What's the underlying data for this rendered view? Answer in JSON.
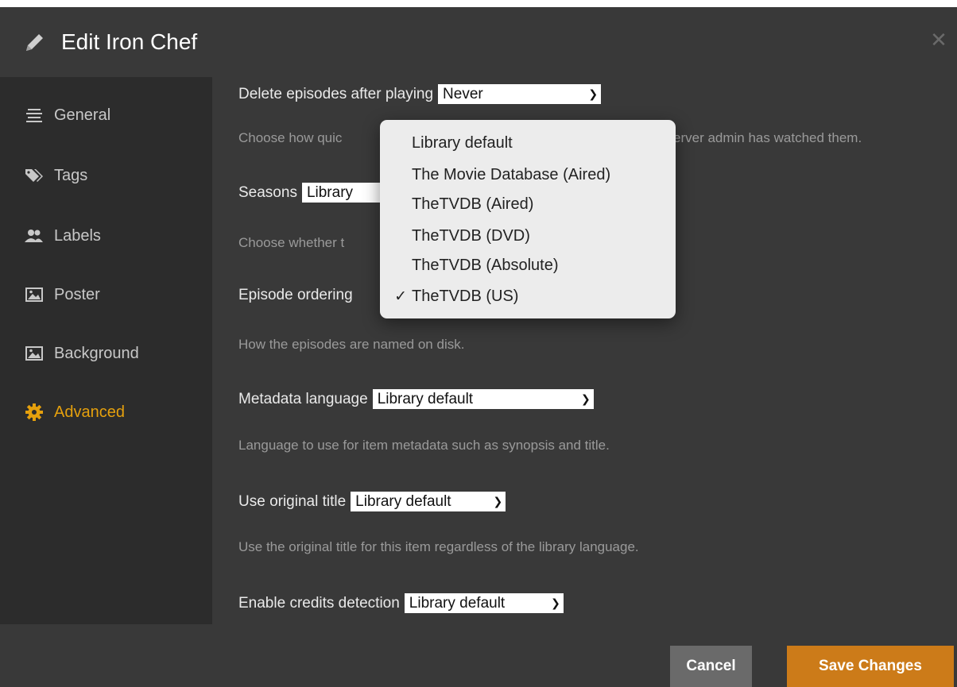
{
  "header": {
    "title": "Edit Iron Chef",
    "close_icon": "close-icon",
    "edit_icon": "pencil-icon"
  },
  "sidebar": {
    "items": [
      {
        "label": "General",
        "icon": "align-center-icon"
      },
      {
        "label": "Tags",
        "icon": "tag-icon"
      },
      {
        "label": "Labels",
        "icon": "users-icon"
      },
      {
        "label": "Poster",
        "icon": "image-icon"
      },
      {
        "label": "Background",
        "icon": "image-icon"
      },
      {
        "label": "Advanced",
        "icon": "gear-icon",
        "active": true
      }
    ]
  },
  "settings": {
    "delete_episodes": {
      "label": "Delete episodes after playing",
      "value": "Never"
    },
    "delete_help": "Choose how quic",
    "delete_help_tail": "erver admin has watched them.",
    "seasons": {
      "label": "Seasons",
      "value": "Library"
    },
    "seasons_help": "Choose whether t",
    "episode_ordering": {
      "label": "Episode ordering"
    },
    "episode_help": "How the episodes are named on disk.",
    "metadata_language": {
      "label": "Metadata language",
      "value": "Library default"
    },
    "metadata_help": "Language to use for item metadata such as synopsis and title.",
    "original_title": {
      "label": "Use original title",
      "value": "Library default"
    },
    "original_title_help": "Use the original title for this item regardless of the library language.",
    "credits_detection": {
      "label": "Enable credits detection",
      "value": "Library default"
    }
  },
  "dropdown": {
    "options": [
      "Library default",
      "The Movie Database (Aired)",
      "TheTVDB (Aired)",
      "TheTVDB (DVD)",
      "TheTVDB (Absolute)",
      "TheTVDB (US)"
    ],
    "selected": "TheTVDB (US)",
    "check_mark": "✓"
  },
  "footer": {
    "cancel_label": "Cancel",
    "save_label": "Save Changes"
  },
  "colors": {
    "accent": "#e5a00d",
    "save_button": "#cc7b19",
    "cancel_button": "#6a6a6a"
  }
}
